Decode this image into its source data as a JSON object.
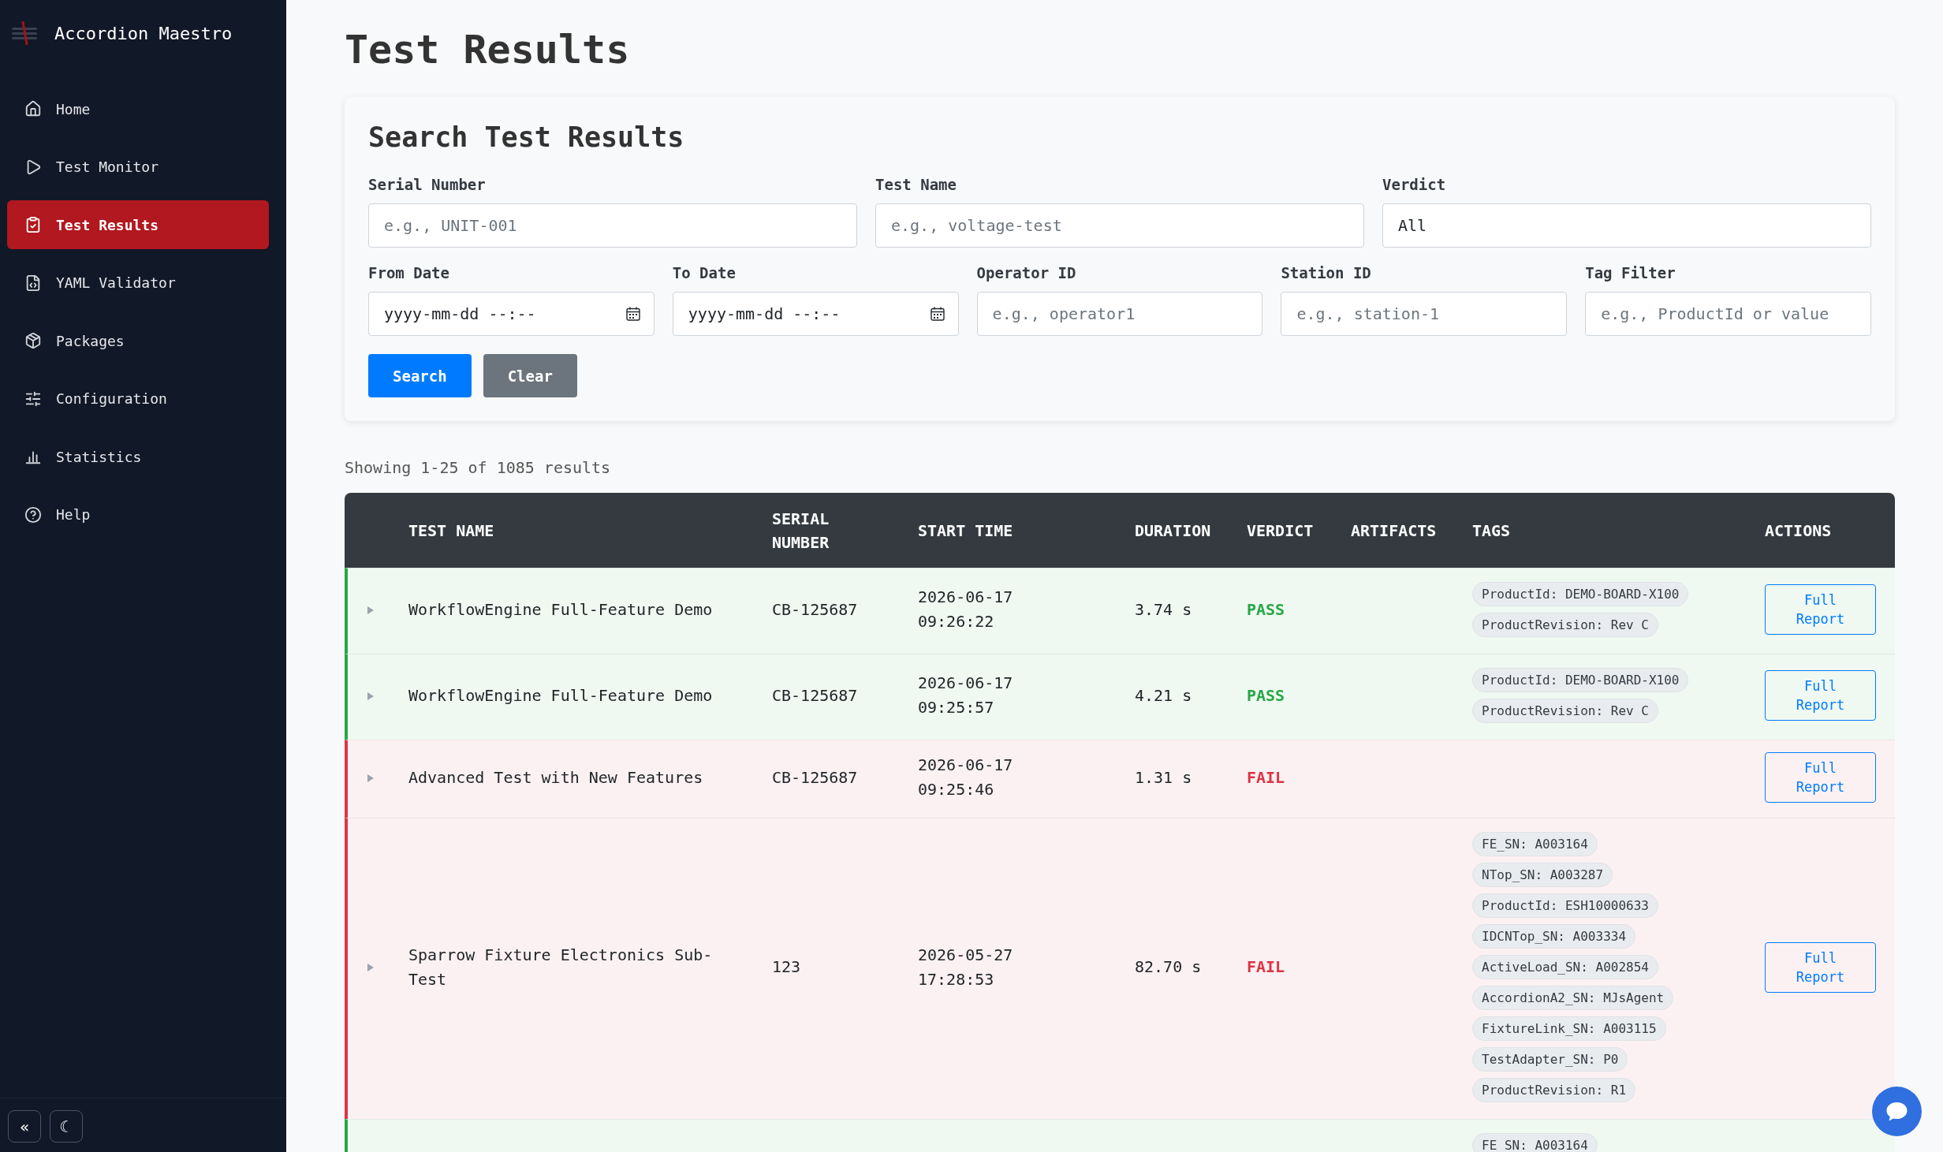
{
  "sidebar": {
    "brand": "Accordion Maestro",
    "items": [
      {
        "label": "Home",
        "selected": false
      },
      {
        "label": "Test Monitor",
        "selected": false
      },
      {
        "label": "Test Results",
        "selected": true
      },
      {
        "label": "YAML Validator",
        "selected": false
      },
      {
        "label": "Packages",
        "selected": false
      },
      {
        "label": "Configuration",
        "selected": false
      },
      {
        "label": "Statistics",
        "selected": false
      },
      {
        "label": "Help",
        "selected": false
      }
    ],
    "footer_buttons": [
      "«",
      "☾"
    ]
  },
  "page_title": "Test Results",
  "search_panel": {
    "title": "Search Test Results",
    "field_rows": [
      [
        {
          "label": "Serial Number",
          "kind": "text",
          "placeholder": "e.g., UNIT-001"
        },
        {
          "label": "Test Name",
          "kind": "text",
          "placeholder": "e.g., voltage-test"
        },
        {
          "label": "Verdict",
          "kind": "select",
          "value": "All"
        }
      ],
      [
        {
          "label": "From Date",
          "kind": "date",
          "placeholder": "yyyy-mm-dd --:--"
        },
        {
          "label": "To Date",
          "kind": "date",
          "placeholder": "yyyy-mm-dd --:--"
        },
        {
          "label": "Operator ID",
          "kind": "text",
          "placeholder": "e.g., operator1"
        },
        {
          "label": "Station ID",
          "kind": "text",
          "placeholder": "e.g., station-1"
        },
        {
          "label": "Tag Filter",
          "kind": "text",
          "placeholder": "e.g., ProductId or value"
        }
      ]
    ],
    "buttons": [
      {
        "label": "Search",
        "kind": "primary"
      },
      {
        "label": "Clear",
        "kind": "secondary"
      }
    ]
  },
  "results_summary": "Showing 1-25 of 1085 results",
  "table": {
    "columns": [
      "TEST NAME",
      "SERIAL NUMBER",
      "START TIME",
      "DURATION",
      "VERDICT",
      "ARTIFACTS",
      "TAGS",
      "ACTIONS"
    ],
    "rows": [
      {
        "kind": "pass",
        "expanded": false,
        "test_name": "WorkflowEngine Full-Feature Demo",
        "serial_number": "CB-125687",
        "start_time": "2026-06-17 09:26:22",
        "duration": "3.74 s",
        "verdict": "PASS",
        "tags": [
          "ProductId: DEMO-BOARD-X100",
          "ProductRevision: Rev C"
        ],
        "action": "Full Report"
      },
      {
        "kind": "pass",
        "expanded": false,
        "test_name": "WorkflowEngine Full-Feature Demo",
        "serial_number": "CB-125687",
        "start_time": "2026-06-17 09:25:57",
        "duration": "4.21 s",
        "verdict": "PASS",
        "tags": [
          "ProductId: DEMO-BOARD-X100",
          "ProductRevision: Rev C"
        ],
        "action": "Full Report"
      },
      {
        "kind": "fail",
        "expanded": false,
        "test_name": "Advanced Test with New Features",
        "serial_number": "CB-125687",
        "start_time": "2026-06-17 09:25:46",
        "duration": "1.31 s",
        "verdict": "FAIL",
        "action": "Full Report"
      },
      {
        "kind": "fail",
        "expanded": false,
        "test_name": "Sparrow Fixture Electronics Sub-Test",
        "serial_number": "123",
        "start_time": "2026-05-27 17:28:53",
        "duration": "82.70 s",
        "verdict": "FAIL",
        "tags": [
          "FE_SN: A003164",
          "NTop_SN: A003287",
          "ProductId: ESH10000633",
          "IDCNTop_SN: A003334",
          "ActiveLoad_SN: A002854",
          "AccordionA2_SN: MJsAgent",
          "FixtureLink_SN: A003115",
          "TestAdapter_SN: P0",
          "ProductRevision: R1"
        ],
        "action": "Full Report"
      },
      {
        "kind": "pass",
        "tags": [
          "FE_SN: A003164"
        ]
      }
    ]
  }
}
